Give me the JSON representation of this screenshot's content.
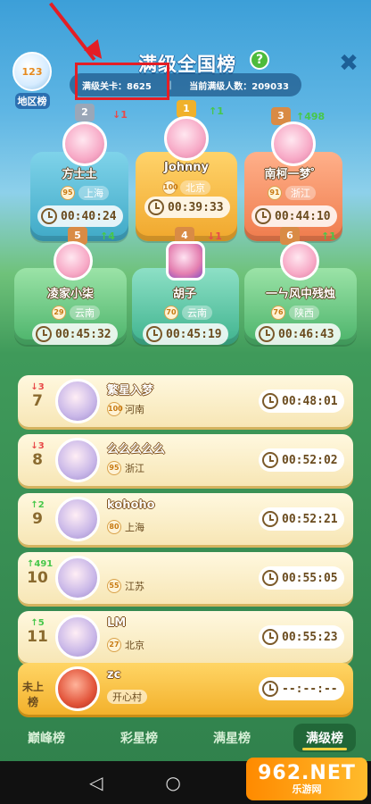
{
  "header": {
    "region_label": "地区榜",
    "title": "满级全国榜",
    "help_symbol": "?",
    "close_symbol": "✖",
    "max_level": "满级关卡：8625",
    "current_count": "当前满级人数：209033"
  },
  "podium": [
    {
      "rank": "2",
      "change": "↓1",
      "change_dir": "down",
      "name": "方士土",
      "level": "95",
      "province": "上海",
      "time": "00:40:24"
    },
    {
      "rank": "1",
      "change": "↑1",
      "change_dir": "up",
      "name": "Johnny",
      "level": "100",
      "province": "北京",
      "time": "00:39:33"
    },
    {
      "rank": "3",
      "change": "↑498",
      "change_dir": "up",
      "name": "南柯一梦゜",
      "level": "91",
      "province": "浙江",
      "time": "00:44:10"
    },
    {
      "rank": "5",
      "change": "↑4",
      "change_dir": "up",
      "name": "凌家小柒",
      "level": "29",
      "province": "云南",
      "time": "00:45:32"
    },
    {
      "rank": "4",
      "change": "↓1",
      "change_dir": "down",
      "name": "胡子",
      "level": "70",
      "province": "云南",
      "time": "00:45:19"
    },
    {
      "rank": "6",
      "change": "↑1",
      "change_dir": "up",
      "name": "一ㄣ风中残烛",
      "level": "76",
      "province": "陕西",
      "time": "00:46:43"
    }
  ],
  "list": [
    {
      "rank": "7",
      "change": "↓3",
      "change_dir": "down",
      "name": "繁星入梦",
      "level": "100",
      "province": "河南",
      "time": "00:48:01"
    },
    {
      "rank": "8",
      "change": "↓3",
      "change_dir": "down",
      "name": "么么么么么",
      "level": "95",
      "province": "浙江",
      "time": "00:52:02"
    },
    {
      "rank": "9",
      "change": "↑2",
      "change_dir": "up",
      "name": "kohoho",
      "level": "80",
      "province": "上海",
      "time": "00:52:21"
    },
    {
      "rank": "10",
      "change": "↑491",
      "change_dir": "up",
      "name": "",
      "level": "55",
      "province": "江苏",
      "time": "00:55:05"
    },
    {
      "rank": "11",
      "change": "↑5",
      "change_dir": "up",
      "name": "LM",
      "level": "27",
      "province": "北京",
      "time": "00:55:23"
    }
  ],
  "mine": {
    "rank": "未上榜",
    "name": "zc",
    "province": "开心村",
    "time": "--:--:--"
  },
  "tabs": [
    "巅峰榜",
    "彩星榜",
    "满星榜",
    "满级榜"
  ],
  "active_tab": "满级榜",
  "navbar": {
    "back": "◁",
    "home": "○"
  },
  "watermark": {
    "big": "962.NET",
    "small": "乐游网"
  }
}
